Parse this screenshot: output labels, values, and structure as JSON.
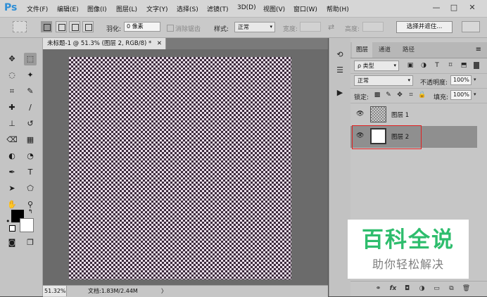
{
  "app": {
    "logo": "Ps"
  },
  "menu": [
    "文件(F)",
    "编辑(E)",
    "图像(I)",
    "图层(L)",
    "文字(Y)",
    "选择(S)",
    "滤镜(T)",
    "3D(D)",
    "视图(V)",
    "窗口(W)",
    "帮助(H)"
  ],
  "window_controls": {
    "minimize": "—",
    "maximize": "□",
    "close": "✕"
  },
  "options": {
    "feather_label": "羽化:",
    "feather_value": "0 像素",
    "antialias_label": "消除锯齿",
    "style_label": "样式:",
    "style_value": "正常",
    "width_label": "宽度:",
    "height_label": "高度:",
    "select_mask_button": "选择并遮住..."
  },
  "document": {
    "tab_title": "未标题-1 @ 51.3% (图层 2, RGB/8) *",
    "tab_close": "✕",
    "zoom": "51.32%",
    "doc_info": "文档:1.83M/2.44M",
    "status_arrow": "〉"
  },
  "panel": {
    "tabs": [
      "图层",
      "通道",
      "路径"
    ],
    "menu_icon": "≡",
    "filter_kind": "ρ 类型",
    "blend_mode": "正常",
    "opacity_label": "不透明度:",
    "opacity_value": "100%",
    "lock_label": "锁定:",
    "fill_label": "填充:",
    "fill_value": "100%",
    "layers": [
      {
        "name": "图层 1",
        "visible": true,
        "selected": false
      },
      {
        "name": "图层 2",
        "visible": true,
        "selected": true
      }
    ]
  },
  "watermark": {
    "main": "百科全说",
    "sub": "助你轻松解决"
  },
  "colors": {
    "accent_blue": "#2d8ed6",
    "watermark_green": "#2ebd6d",
    "highlight_red": "#e02020"
  },
  "icons": {
    "tools": [
      "move-icon",
      "marquee-icon",
      "lasso-icon",
      "magic-wand-icon",
      "crop-icon",
      "eyedropper-icon",
      "healing-brush-icon",
      "brush-icon",
      "stamp-icon",
      "history-brush-icon",
      "eraser-icon",
      "gradient-icon",
      "blur-icon",
      "dodge-icon",
      "pen-icon",
      "text-icon",
      "path-select-icon",
      "shape-icon",
      "hand-icon",
      "zoom-icon",
      "more-tools-icon"
    ]
  }
}
